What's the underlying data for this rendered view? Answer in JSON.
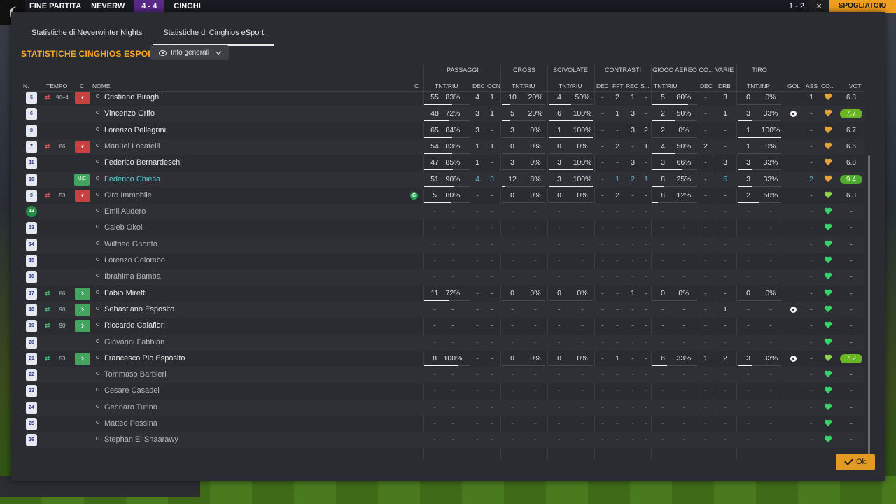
{
  "background": {
    "match_status": "FINE PARTITA",
    "home_short": "NEVERW",
    "score": "4 - 4",
    "away_short": "CINGHI",
    "right_score": "1 - 2",
    "dressing_room_label": "SPOGLIATOIO",
    "close_icon": "close-icon"
  },
  "tabs": [
    {
      "label": "Statistiche di Neverwinter Nights",
      "active": false
    },
    {
      "label": "Statistiche di Cinghios eSport",
      "active": true
    }
  ],
  "team_title": "STATISTICHE CINGHIOS ESPORT",
  "view_select": {
    "label": "Info generali",
    "icon": "eye-icon"
  },
  "groups": {
    "passaggi": "PASSAGGI",
    "cross": "CROSS",
    "scivolate": "SCIVOLATE",
    "contrasti": "CONTRASTI",
    "gioco_aereo": "GIOCO AEREO",
    "co": "CO...",
    "varie": "VARIE",
    "tiro": "TIRO"
  },
  "columns": {
    "n": "N.",
    "tempo": "TEMPO",
    "c": "C",
    "nome": "NOME",
    "c2": "C",
    "pass_tnt": "TNT/RIU",
    "pass_dec": "DEC",
    "pass_ocn": "OCN",
    "cross_tnt": "TNT/RIU",
    "sciv_tnt": "TNT/RIU",
    "con_dec": "DEC",
    "con_fft": "FFT",
    "con_rec": "REC",
    "con_s": "S...",
    "aer_tnt": "TNT/RIU",
    "co_dec": "DEC",
    "varie_drb": "DRB",
    "tiro_tnt": "TNT\\INP",
    "gol": "GOL",
    "ass": "ASS",
    "co2": "CO...",
    "vot": "VOT"
  },
  "rows": [
    {
      "num": "5",
      "min": "90+4",
      "sub": "out",
      "name": "Cristiano Biraghi",
      "status": "normal",
      "pass": [
        "55",
        "83%"
      ],
      "pass_bar": 0.83,
      "dec": "4",
      "ocn": "1",
      "cross": [
        "10",
        "20%"
      ],
      "sciv": [
        "4",
        "50%"
      ],
      "con": [
        "-",
        "2",
        "1",
        "-"
      ],
      "aer": [
        "5",
        "80%"
      ],
      "co": "-",
      "drb": "3",
      "tiro": [
        "0",
        "0%"
      ],
      "gol": "",
      "ass": "1",
      "heart": "gold",
      "vot": "6.8",
      "vot_class": ""
    },
    {
      "num": "6",
      "min": "",
      "sub": "",
      "name": "Vincenzo Grifo",
      "status": "normal",
      "pass": [
        "48",
        "72%"
      ],
      "pass_bar": 0.72,
      "dec": "3",
      "ocn": "1",
      "cross": [
        "5",
        "20%"
      ],
      "sciv": [
        "6",
        "100%"
      ],
      "con": [
        "-",
        "1",
        "3",
        "-"
      ],
      "aer": [
        "2",
        "50%"
      ],
      "co": "-",
      "drb": "1",
      "tiro": [
        "3",
        "33%"
      ],
      "gol": "ball",
      "ass": "-",
      "heart": "gold",
      "vot": "7.7",
      "vot_class": "good"
    },
    {
      "num": "8",
      "min": "",
      "sub": "",
      "name": "Lorenzo Pellegrini",
      "status": "normal",
      "pass": [
        "65",
        "84%"
      ],
      "pass_bar": 0.84,
      "dec": "3",
      "ocn": "-",
      "cross": [
        "3",
        "0%"
      ],
      "sciv": [
        "1",
        "100%"
      ],
      "con": [
        "-",
        "-",
        "3",
        "2"
      ],
      "aer": [
        "2",
        "0%"
      ],
      "co": "-",
      "drb": "-",
      "tiro": [
        "1",
        "100%"
      ],
      "gol": "",
      "ass": "-",
      "heart": "gold",
      "vot": "6.7",
      "vot_class": ""
    },
    {
      "num": "7",
      "min": "86",
      "sub": "out",
      "name": "Manuel Locatelli",
      "status": "dim",
      "pass": [
        "54",
        "83%"
      ],
      "pass_bar": 0.83,
      "dec": "1",
      "ocn": "1",
      "cross": [
        "0",
        "0%"
      ],
      "sciv": [
        "0",
        "0%"
      ],
      "con": [
        "-",
        "2",
        "-",
        "1"
      ],
      "aer": [
        "4",
        "50%"
      ],
      "co": "2",
      "drb": "-",
      "tiro": [
        "1",
        "0%"
      ],
      "gol": "",
      "ass": "-",
      "heart": "gold",
      "vot": "6.6",
      "vot_class": ""
    },
    {
      "num": "11",
      "min": "",
      "sub": "",
      "name": "Federico Bernardeschi",
      "status": "normal",
      "pass": [
        "47",
        "85%"
      ],
      "pass_bar": 0.85,
      "dec": "1",
      "ocn": "-",
      "cross": [
        "3",
        "0%"
      ],
      "sciv": [
        "3",
        "100%"
      ],
      "con": [
        "-",
        "-",
        "3",
        "-"
      ],
      "aer": [
        "3",
        "66%"
      ],
      "co": "-",
      "drb": "3",
      "tiro": [
        "3",
        "33%"
      ],
      "gol": "",
      "ass": "-",
      "heart": "gold",
      "vot": "6.8",
      "vot_class": ""
    },
    {
      "num": "10",
      "min": "",
      "sub": "mic",
      "name": "Federico Chiesa",
      "status": "mom",
      "pass": [
        "51",
        "90%"
      ],
      "pass_bar": 0.9,
      "dec": "4",
      "ocn": "3",
      "cross": [
        "12",
        "8%"
      ],
      "sciv": [
        "3",
        "100%"
      ],
      "con": [
        "-",
        "1",
        "2",
        "1"
      ],
      "aer": [
        "8",
        "25%"
      ],
      "co": "-",
      "drb": "5",
      "tiro": [
        "3",
        "33%"
      ],
      "gol": "",
      "ass": "2",
      "heart": "gold",
      "vot": "9.4",
      "vot_class": "best"
    },
    {
      "num": "9",
      "min": "53",
      "sub": "out",
      "name": "Ciro Immobile",
      "status": "dim",
      "captain": "C",
      "pass": [
        "5",
        "80%"
      ],
      "pass_bar": 0.8,
      "dec": "-",
      "ocn": "-",
      "cross": [
        "0",
        "0%"
      ],
      "sciv": [
        "0",
        "0%"
      ],
      "con": [
        "-",
        "2",
        "-",
        "-"
      ],
      "aer": [
        "8",
        "12%"
      ],
      "co": "-",
      "drb": "-",
      "tiro": [
        "2",
        "50%"
      ],
      "gol": "",
      "ass": "-",
      "heart": "lgreen",
      "vot": "6.3",
      "vot_class": ""
    },
    {
      "num": "12",
      "gk": true,
      "min": "",
      "sub": "",
      "name": "Emil Audero",
      "status": "bench",
      "pass": [
        "-",
        "-"
      ],
      "pass_bar": 0,
      "dec": "-",
      "ocn": "-",
      "cross": [
        "-",
        "-"
      ],
      "sciv": [
        "-",
        "-"
      ],
      "con": [
        "-",
        "-",
        "-",
        "-"
      ],
      "aer": [
        "-",
        "-"
      ],
      "co": "-",
      "drb": "-",
      "tiro": [
        "-",
        "-"
      ],
      "gol": "",
      "ass": "-",
      "heart": "green",
      "vot": "-",
      "vot_class": ""
    },
    {
      "num": "13",
      "min": "",
      "sub": "",
      "name": "Caleb Okoli",
      "status": "bench",
      "pass": [
        "-",
        "-"
      ],
      "pass_bar": 0,
      "dec": "-",
      "ocn": "-",
      "cross": [
        "-",
        "-"
      ],
      "sciv": [
        "-",
        "-"
      ],
      "con": [
        "-",
        "-",
        "-",
        "-"
      ],
      "aer": [
        "-",
        "-"
      ],
      "co": "-",
      "drb": "-",
      "tiro": [
        "-",
        "-"
      ],
      "gol": "",
      "ass": "-",
      "heart": "green",
      "vot": "-",
      "vot_class": ""
    },
    {
      "num": "14",
      "min": "",
      "sub": "",
      "name": "Wilfried Gnonto",
      "status": "bench",
      "pass": [
        "-",
        "-"
      ],
      "pass_bar": 0,
      "dec": "-",
      "ocn": "-",
      "cross": [
        "-",
        "-"
      ],
      "sciv": [
        "-",
        "-"
      ],
      "con": [
        "-",
        "-",
        "-",
        "-"
      ],
      "aer": [
        "-",
        "-"
      ],
      "co": "-",
      "drb": "-",
      "tiro": [
        "-",
        "-"
      ],
      "gol": "",
      "ass": "-",
      "heart": "green",
      "vot": "-",
      "vot_class": ""
    },
    {
      "num": "15",
      "min": "",
      "sub": "",
      "name": "Lorenzo Colombo",
      "status": "bench",
      "pass": [
        "-",
        "-"
      ],
      "pass_bar": 0,
      "dec": "-",
      "ocn": "-",
      "cross": [
        "-",
        "-"
      ],
      "sciv": [
        "-",
        "-"
      ],
      "con": [
        "-",
        "-",
        "-",
        "-"
      ],
      "aer": [
        "-",
        "-"
      ],
      "co": "-",
      "drb": "-",
      "tiro": [
        "-",
        "-"
      ],
      "gol": "",
      "ass": "-",
      "heart": "green",
      "vot": "-",
      "vot_class": ""
    },
    {
      "num": "16",
      "min": "",
      "sub": "",
      "name": "Ibrahima Bamba",
      "status": "bench",
      "pass": [
        "-",
        "-"
      ],
      "pass_bar": 0,
      "dec": "-",
      "ocn": "-",
      "cross": [
        "-",
        "-"
      ],
      "sciv": [
        "-",
        "-"
      ],
      "con": [
        "-",
        "-",
        "-",
        "-"
      ],
      "aer": [
        "-",
        "-"
      ],
      "co": "-",
      "drb": "-",
      "tiro": [
        "-",
        "-"
      ],
      "gol": "",
      "ass": "-",
      "heart": "green",
      "vot": "-",
      "vot_class": ""
    },
    {
      "num": "17",
      "min": "86",
      "sub": "in",
      "name": "Fabio Miretti",
      "status": "normal",
      "pass": [
        "11",
        "72%"
      ],
      "pass_bar": 0.72,
      "dec": "-",
      "ocn": "-",
      "cross": [
        "0",
        "0%"
      ],
      "sciv": [
        "0",
        "0%"
      ],
      "con": [
        "-",
        "-",
        "1",
        "-"
      ],
      "aer": [
        "0",
        "0%"
      ],
      "co": "-",
      "drb": "-",
      "tiro": [
        "0",
        "0%"
      ],
      "gol": "",
      "ass": "-",
      "heart": "green",
      "vot": "-",
      "vot_class": ""
    },
    {
      "num": "18",
      "min": "90",
      "sub": "in",
      "name": "Sebastiano Esposito",
      "status": "normal",
      "pass": [
        "-",
        "-"
      ],
      "pass_bar": 0,
      "dec": "-",
      "ocn": "-",
      "cross": [
        "-",
        "-"
      ],
      "sciv": [
        "-",
        "-"
      ],
      "con": [
        "-",
        "-",
        "-",
        "-"
      ],
      "aer": [
        "-",
        "-"
      ],
      "co": "-",
      "drb": "1",
      "tiro": [
        "-",
        "-"
      ],
      "gol": "ball",
      "ass": "-",
      "heart": "green",
      "vot": "-",
      "vot_class": ""
    },
    {
      "num": "19",
      "min": "90",
      "sub": "in",
      "name": "Riccardo Calafiori",
      "status": "normal",
      "pass": [
        "-",
        "-"
      ],
      "pass_bar": 0,
      "dec": "-",
      "ocn": "-",
      "cross": [
        "-",
        "-"
      ],
      "sciv": [
        "-",
        "-"
      ],
      "con": [
        "-",
        "-",
        "-",
        "-"
      ],
      "aer": [
        "-",
        "-"
      ],
      "co": "-",
      "drb": "-",
      "tiro": [
        "-",
        "-"
      ],
      "gol": "",
      "ass": "-",
      "heart": "green",
      "vot": "-",
      "vot_class": ""
    },
    {
      "num": "20",
      "min": "",
      "sub": "",
      "name": "Giovanni Fabbian",
      "status": "bench",
      "pass": [
        "-",
        "-"
      ],
      "pass_bar": 0,
      "dec": "-",
      "ocn": "-",
      "cross": [
        "-",
        "-"
      ],
      "sciv": [
        "-",
        "-"
      ],
      "con": [
        "-",
        "-",
        "-",
        "-"
      ],
      "aer": [
        "-",
        "-"
      ],
      "co": "-",
      "drb": "-",
      "tiro": [
        "-",
        "-"
      ],
      "gol": "",
      "ass": "-",
      "heart": "green",
      "vot": "-",
      "vot_class": ""
    },
    {
      "num": "21",
      "min": "53",
      "sub": "in",
      "name": "Francesco Pio Esposito",
      "status": "normal",
      "pass": [
        "8",
        "100%"
      ],
      "pass_bar": 1.0,
      "dec": "-",
      "ocn": "-",
      "cross": [
        "0",
        "0%"
      ],
      "sciv": [
        "0",
        "0%"
      ],
      "con": [
        "-",
        "1",
        "-",
        "-"
      ],
      "aer": [
        "6",
        "33%"
      ],
      "co": "1",
      "drb": "2",
      "tiro": [
        "3",
        "33%"
      ],
      "gol": "ball",
      "ass": "-",
      "heart": "lgreen",
      "vot": "7.2",
      "vot_class": "good"
    },
    {
      "num": "22",
      "min": "",
      "sub": "",
      "name": "Tommaso Barbieri",
      "status": "bench",
      "pass": [
        "-",
        "-"
      ],
      "pass_bar": 0,
      "dec": "-",
      "ocn": "-",
      "cross": [
        "-",
        "-"
      ],
      "sciv": [
        "-",
        "-"
      ],
      "con": [
        "-",
        "-",
        "-",
        "-"
      ],
      "aer": [
        "-",
        "-"
      ],
      "co": "-",
      "drb": "-",
      "tiro": [
        "-",
        "-"
      ],
      "gol": "",
      "ass": "-",
      "heart": "green",
      "vot": "-",
      "vot_class": ""
    },
    {
      "num": "23",
      "min": "",
      "sub": "",
      "name": "Cesare Casadei",
      "status": "bench",
      "pass": [
        "-",
        "-"
      ],
      "pass_bar": 0,
      "dec": "-",
      "ocn": "-",
      "cross": [
        "-",
        "-"
      ],
      "sciv": [
        "-",
        "-"
      ],
      "con": [
        "-",
        "-",
        "-",
        "-"
      ],
      "aer": [
        "-",
        "-"
      ],
      "co": "-",
      "drb": "-",
      "tiro": [
        "-",
        "-"
      ],
      "gol": "",
      "ass": "-",
      "heart": "green",
      "vot": "-",
      "vot_class": ""
    },
    {
      "num": "24",
      "min": "",
      "sub": "",
      "name": "Gennaro Tutino",
      "status": "bench",
      "pass": [
        "-",
        "-"
      ],
      "pass_bar": 0,
      "dec": "-",
      "ocn": "-",
      "cross": [
        "-",
        "-"
      ],
      "sciv": [
        "-",
        "-"
      ],
      "con": [
        "-",
        "-",
        "-",
        "-"
      ],
      "aer": [
        "-",
        "-"
      ],
      "co": "-",
      "drb": "-",
      "tiro": [
        "-",
        "-"
      ],
      "gol": "",
      "ass": "-",
      "heart": "green",
      "vot": "-",
      "vot_class": ""
    },
    {
      "num": "25",
      "min": "",
      "sub": "",
      "name": "Matteo Pessina",
      "status": "bench",
      "pass": [
        "-",
        "-"
      ],
      "pass_bar": 0,
      "dec": "-",
      "ocn": "-",
      "cross": [
        "-",
        "-"
      ],
      "sciv": [
        "-",
        "-"
      ],
      "con": [
        "-",
        "-",
        "-",
        "-"
      ],
      "aer": [
        "-",
        "-"
      ],
      "co": "-",
      "drb": "-",
      "tiro": [
        "-",
        "-"
      ],
      "gol": "",
      "ass": "-",
      "heart": "green",
      "vot": "-",
      "vot_class": ""
    },
    {
      "num": "26",
      "min": "",
      "sub": "",
      "name": "Stephan El Shaarawy",
      "status": "bench",
      "pass": [
        "-",
        "-"
      ],
      "pass_bar": 0,
      "dec": "-",
      "ocn": "-",
      "cross": [
        "-",
        "-"
      ],
      "sciv": [
        "-",
        "-"
      ],
      "con": [
        "-",
        "-",
        "-",
        "-"
      ],
      "aer": [
        "-",
        "-"
      ],
      "co": "-",
      "drb": "-",
      "tiro": [
        "-",
        "-"
      ],
      "gol": "",
      "ass": "-",
      "heart": "green",
      "vot": "-",
      "vot_class": ""
    }
  ],
  "ok_label": "Ok",
  "colors": {
    "accent": "#f4a726",
    "positive": "#43a45f",
    "negative": "#c84040",
    "rating_good": "#6ab524"
  }
}
